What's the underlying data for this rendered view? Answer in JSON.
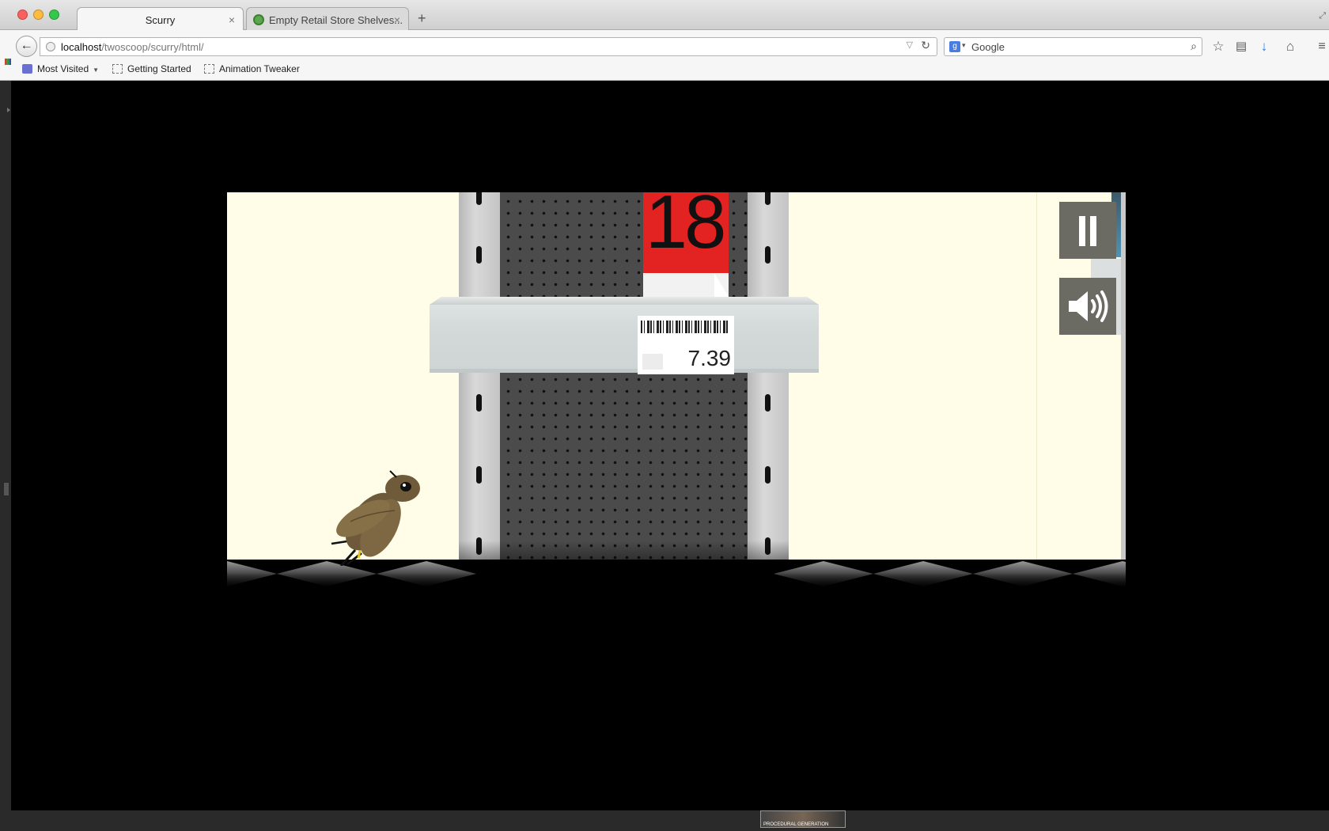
{
  "browser": {
    "tabs": [
      {
        "label": "Scurry",
        "active": true
      },
      {
        "label": "Empty Retail Store Shelves...",
        "active": false
      }
    ],
    "url": {
      "host": "localhost",
      "path": "/twoscoop/scurry/html/"
    },
    "search": {
      "placeholder": "Google"
    },
    "bookmarks": [
      {
        "label": "Most Visited",
        "icon": "folder-icon",
        "dropdown": true
      },
      {
        "label": "Getting Started",
        "icon": "page-icon"
      },
      {
        "label": "Animation Tweaker",
        "icon": "page-icon"
      }
    ],
    "bottom_thumbnail_text": "PROCEDURAL GENERATION"
  },
  "game": {
    "score": "18",
    "price": "7.39",
    "controls": {
      "pause": "pause-icon",
      "sound": "speaker-icon"
    },
    "colors": {
      "background": "#fffde8",
      "product": "#e32222",
      "button": "#6b6b63",
      "pegboard": "#4b4b4b"
    }
  }
}
